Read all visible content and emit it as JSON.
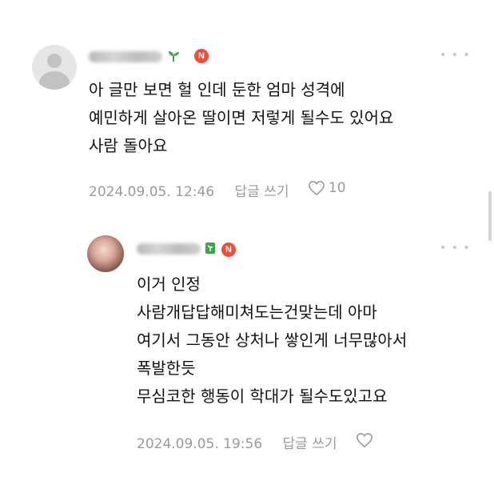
{
  "comments": [
    {
      "avatar": "default-avatar",
      "level_icon": "sprout-icon",
      "badge": "N",
      "lines": [
        "아 글만 보면 헐 인데 둔한 엄마 성격에",
        "예민하게 살아온 딸이면 저렇게 될수도 있어요",
        "사람 돌아요"
      ],
      "date": "2024.09.05. 12:46",
      "reply_label": "답글 쓰기",
      "like_count": "10"
    },
    {
      "avatar": "photo-avatar",
      "level_icon": "leaf-icon",
      "badge": "N",
      "lines": [
        "이거 인정",
        "사람개답답해미쳐도는건맞는데 아마",
        "여기서 그동안 상처나 쌓인게 너무많아서",
        "폭발한듯",
        "무심코한 행동이 학대가 될수도있고요"
      ],
      "date": "2024.09.05. 19:56",
      "reply_label": "답글 쓰기",
      "like_count": ""
    }
  ],
  "more_glyph": "• • •",
  "colors": {
    "badge_red": "#f04e37",
    "level_green": "#3aa54a",
    "meta_gray": "#9a9a9a"
  }
}
